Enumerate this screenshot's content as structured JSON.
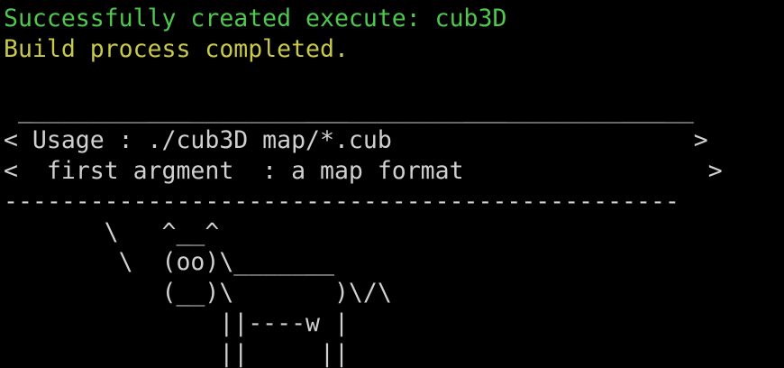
{
  "colors": {
    "background": "#000000",
    "success_text": "#4ec94e",
    "status_text": "#c8c84a",
    "default_text": "#d0d0d0"
  },
  "output": {
    "success_message": "Successfully created execute: cub3D",
    "build_status": "Build process completed.",
    "blank": "",
    "bubble_top": " _______________________________________________",
    "usage_line": "< Usage : ./cub3D map/*.cub                     >",
    "arg_line": "<  first argment  : a map format                 >",
    "bubble_bottom": "-----------------------------------------------",
    "cow_line_1": "       \\   ^__^",
    "cow_line_2": "        \\  (oo)\\_______",
    "cow_line_3": "           (__)\\       )\\/\\",
    "cow_line_4": "               ||----w |",
    "cow_line_5": "               ||     ||"
  }
}
